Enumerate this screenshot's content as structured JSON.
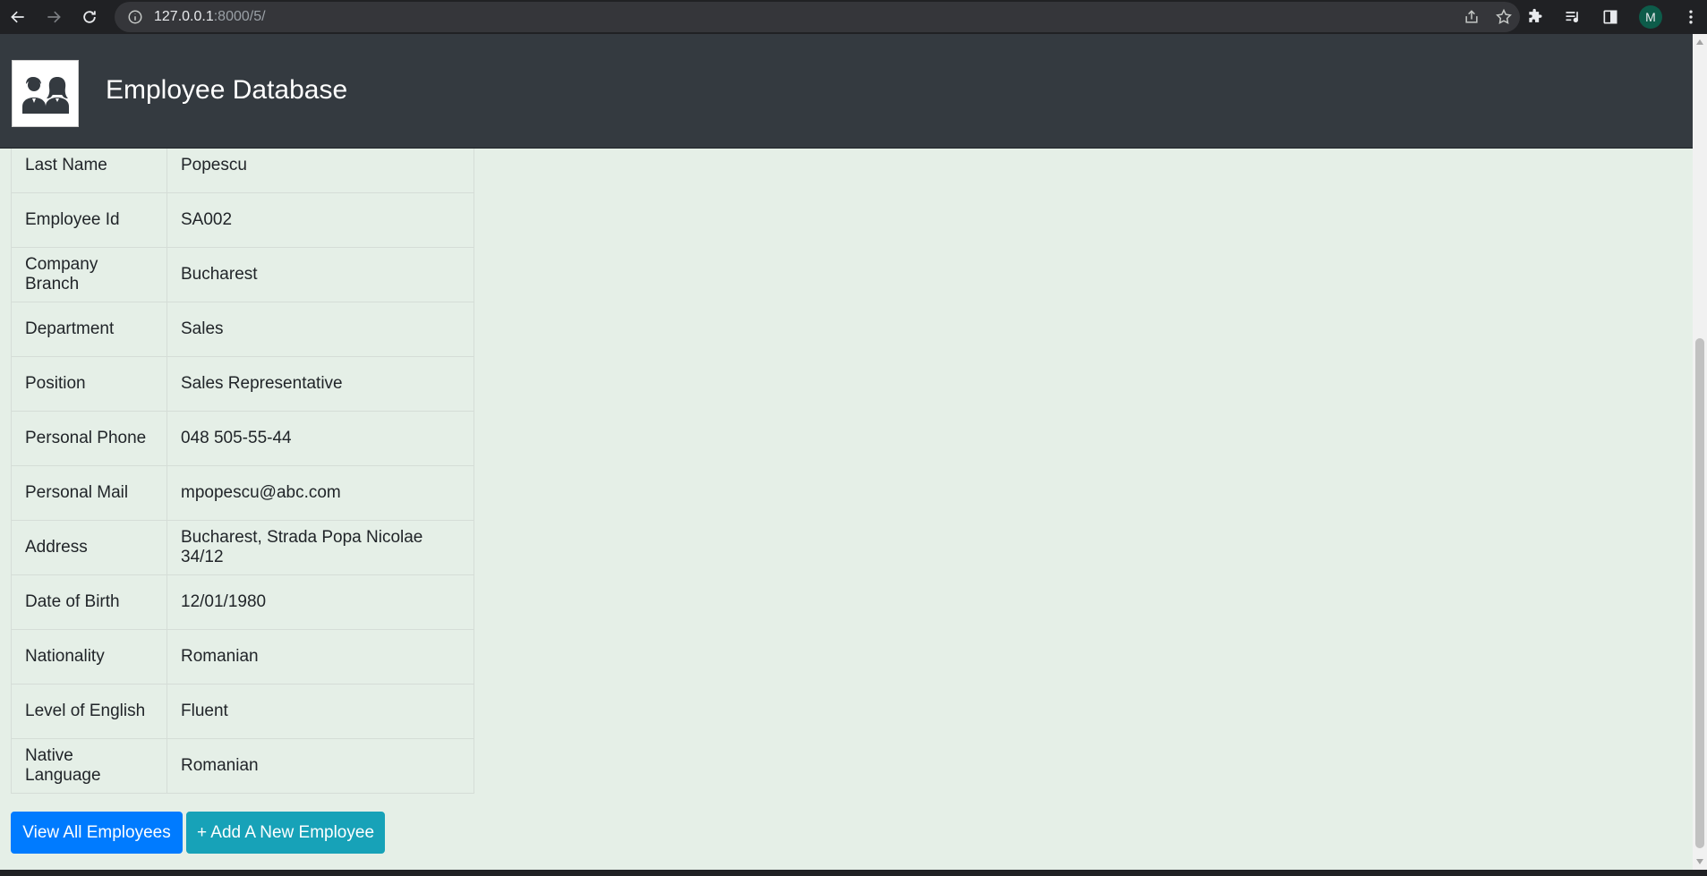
{
  "browser": {
    "url_host": "127.0.0.1",
    "url_rest": ":8000/5/",
    "profile_initial": "M"
  },
  "header": {
    "title": "Employee Database"
  },
  "details": [
    {
      "label": "Last Name",
      "value": "Popescu"
    },
    {
      "label": "Employee Id",
      "value": "SA002"
    },
    {
      "label": "Company Branch",
      "value": "Bucharest"
    },
    {
      "label": "Department",
      "value": "Sales"
    },
    {
      "label": "Position",
      "value": "Sales Representative"
    },
    {
      "label": "Personal Phone",
      "value": "048 505-55-44"
    },
    {
      "label": "Personal Mail",
      "value": "mpopescu@abc.com"
    },
    {
      "label": "Address",
      "value": "Bucharest, Strada Popa Nicolae 34/12"
    },
    {
      "label": "Date of Birth",
      "value": "12/01/1980"
    },
    {
      "label": "Nationality",
      "value": "Romanian"
    },
    {
      "label": "Level of English",
      "value": "Fluent"
    },
    {
      "label": "Native Language",
      "value": "Romanian"
    }
  ],
  "actions": {
    "view_all_label": "View All Employees",
    "add_new_label": "+ Add A New Employee"
  },
  "colors": {
    "page_bg": "#e5efe7",
    "header_bg": "#343a40",
    "primary": "#007bff",
    "info": "#17a2b8"
  }
}
